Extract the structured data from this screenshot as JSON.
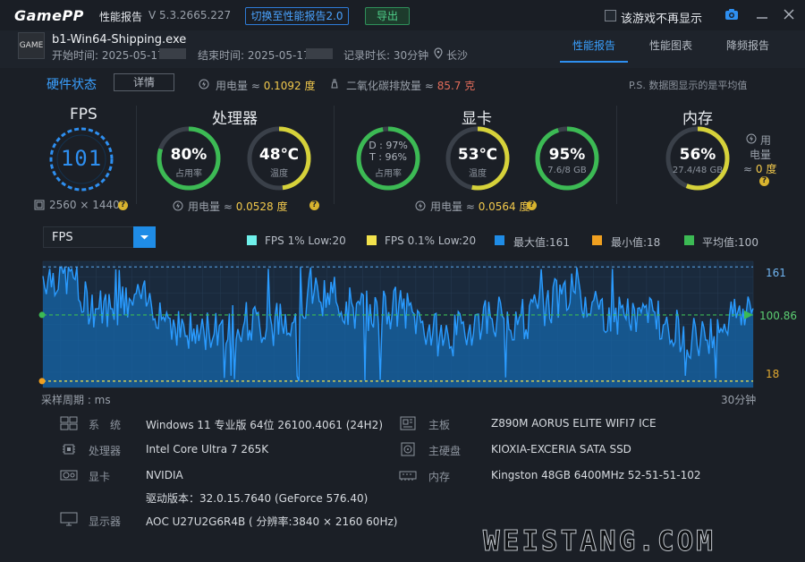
{
  "app": {
    "logo": "GamePP",
    "title": "性能报告",
    "version": "V 5.3.2665.227",
    "switch_button": "切换至性能报告2.0",
    "export_button": "导出",
    "hide_checkbox_label": "该游戏不再显示"
  },
  "game": {
    "icon_text": "GAME",
    "name": "b1-Win64-Shipping.exe",
    "start_time": "开始时间: 2025-05-17",
    "end_time": "结束时间: 2025-05-17",
    "duration": "记录时长: 30分钟",
    "location": "长沙"
  },
  "tabs": [
    {
      "label": "性能报告",
      "active": true
    },
    {
      "label": "性能图表",
      "active": false
    },
    {
      "label": "降频报告",
      "active": false
    }
  ],
  "hardware": {
    "title": "硬件状态",
    "detail_button": "详情",
    "power_label": "用电量 ≈",
    "power_value": "0.1092 度",
    "co2_label": "二氧化碳排放量 ≈",
    "co2_value": "85.7 克",
    "note": "P.S. 数据图显示的是平均值"
  },
  "fps": {
    "title": "FPS",
    "value": "101",
    "resolution": "2560 × 1440"
  },
  "cpu": {
    "title": "处理器",
    "usage_value": "80%",
    "usage_label": "占用率",
    "usage_fraction": 0.8,
    "temp_value": "48℃",
    "temp_label": "温度",
    "temp_fraction": 0.48,
    "power_label": "用电量 ≈",
    "power_value": "0.0528 度"
  },
  "gpu": {
    "title": "显卡",
    "d_line": "D : 97%",
    "t_line": "T : 96%",
    "usage_label": "占用率",
    "usage_fraction": 0.97,
    "temp_value": "53℃",
    "temp_label": "温度",
    "temp_fraction": 0.53,
    "vram_value": "95%",
    "vram_label": "7.6/8 GB",
    "vram_fraction": 0.95,
    "power_label": "用电量 ≈",
    "power_value": "0.0564 度"
  },
  "memory": {
    "title": "内存",
    "usage_value": "56%",
    "usage_label": "27.4/48 GB",
    "usage_fraction": 0.56,
    "power_label_1": "用",
    "power_label_2": "电量",
    "power_label_3": "≈",
    "power_value": "0 度"
  },
  "chart_data": {
    "type": "line",
    "metric_select": "FPS",
    "legend": [
      {
        "label": "FPS 1% Low:20",
        "color": "#6ff0ea"
      },
      {
        "label": "FPS 0.1% Low:20",
        "color": "#f2e24c"
      },
      {
        "label": "最大值:161",
        "color": "#1f8ce6"
      },
      {
        "label": "最小值:18",
        "color": "#f0a020"
      },
      {
        "label": "平均值:100",
        "color": "#3cba54"
      }
    ],
    "max": 161,
    "min": 18,
    "avg": 100.86,
    "max_label": "161",
    "min_label": "18",
    "avg_label": "100.86",
    "ylim": [
      10,
      168
    ],
    "x_start_label": "采样周期 : ms",
    "x_end_label": "30分钟"
  },
  "system": {
    "os_label": "系　统",
    "os_value": "Windows 11 专业版 64位 26100.4061 (24H2)",
    "cpu_label": "处理器",
    "cpu_value": "Intel Core Ultra 7 265K",
    "gpu_label": "显卡",
    "gpu_value": "NVIDIA",
    "driver_value": "驱动版本：32.0.15.7640 (GeForce 576.40)",
    "monitor_label": "显示器",
    "monitor_value": "AOC U27U2G6R4B ( 分辨率:3840 × 2160 60Hz)",
    "board_label": "主板",
    "board_value": "Z890M AORUS ELITE WIFI7 ICE",
    "disk_label": "主硬盘",
    "disk_value": "KIOXIA-EXCERIA SATA SSD",
    "ram_label": "内存",
    "ram_value": "Kingston 48GB 6400MHz 52-51-51-102"
  },
  "watermark": "WEISTANG.COM",
  "colors": {
    "accent": "#3aa0ff",
    "ring_green": "#3cba54",
    "ring_yellow": "#d6d23a",
    "warn": "#f2c94c"
  }
}
